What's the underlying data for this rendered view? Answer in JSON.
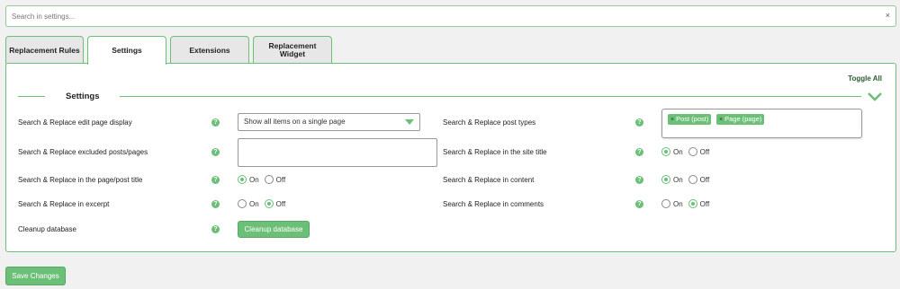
{
  "search": {
    "placeholder": "Search in settings...",
    "clear_glyph": "×"
  },
  "tabs": [
    {
      "label": "Replacement Rules",
      "active": false
    },
    {
      "label": "Settings",
      "active": true
    },
    {
      "label": "Extensions",
      "active": false
    },
    {
      "label": "Replacement Widget",
      "active": false
    }
  ],
  "panel": {
    "toggle_all": "Toggle All",
    "section_title": "Settings",
    "help_glyph": "?",
    "left": [
      {
        "label": "Search & Replace edit page display",
        "control": "select",
        "value": "Show all items on a single page"
      },
      {
        "label": "Search & Replace excluded posts/pages",
        "control": "textarea",
        "value": ""
      },
      {
        "label": "Search & Replace in the page/post title",
        "control": "radio",
        "value": "On"
      },
      {
        "label": "Search & Replace in excerpt",
        "control": "radio",
        "value": "Off"
      },
      {
        "label": "Cleanup database",
        "control": "button",
        "value": "Cleanup database"
      }
    ],
    "right": [
      {
        "label": "Search & Replace post types",
        "control": "multiselect",
        "chips": [
          "Post (post)",
          "Page (page)"
        ]
      },
      {
        "label": "Search & Replace in the site title",
        "control": "radio",
        "value": "On"
      },
      {
        "label": "Search & Replace in content",
        "control": "radio",
        "value": "On"
      },
      {
        "label": "Search & Replace in comments",
        "control": "radio",
        "value": "Off"
      }
    ],
    "radio_on": "On",
    "radio_off": "Off",
    "chip_remove_glyph": "×"
  },
  "footer": {
    "save_label": "Save Changes"
  },
  "colors": {
    "accent": "#6cbf77",
    "background": "#f1f1f1"
  }
}
